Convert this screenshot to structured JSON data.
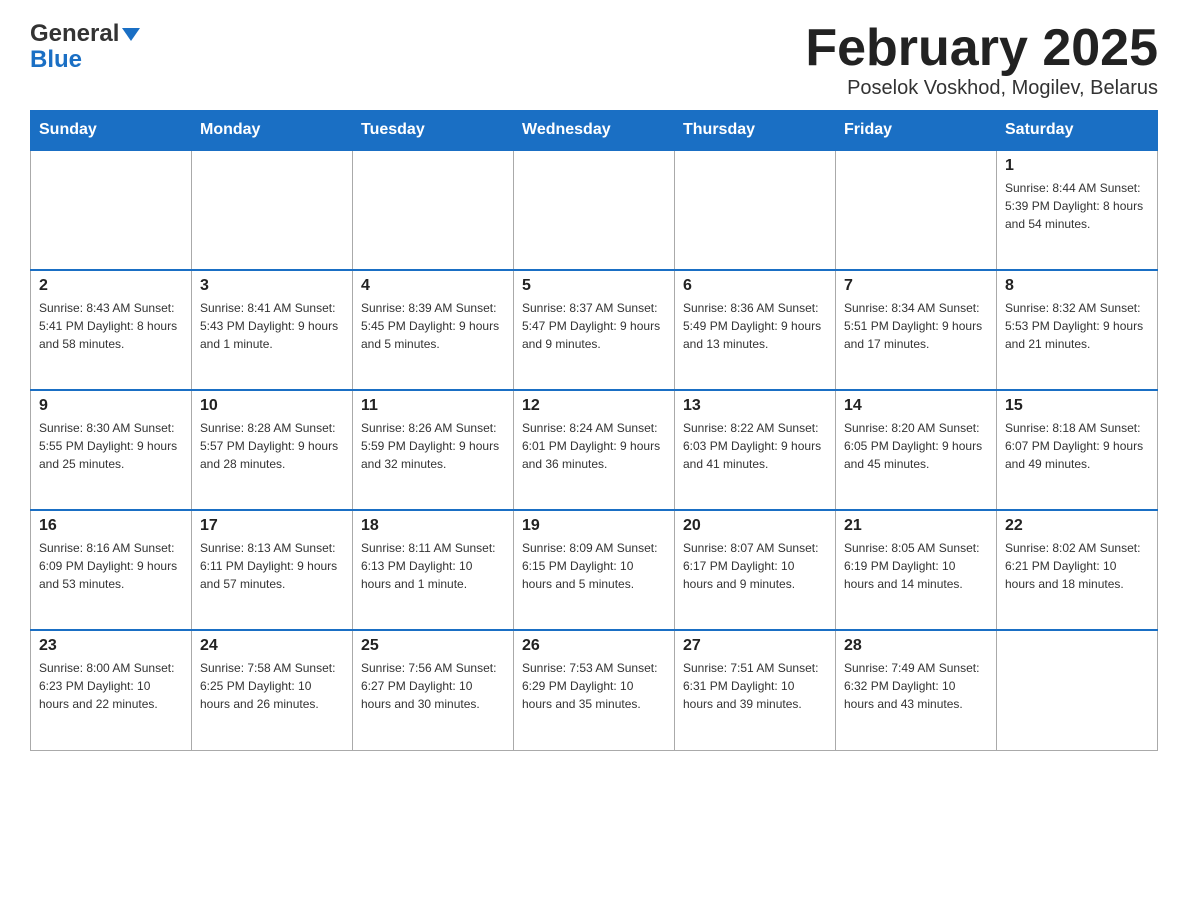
{
  "header": {
    "logo_line1": "General",
    "logo_line2": "Blue",
    "month_title": "February 2025",
    "location": "Poselok Voskhod, Mogilev, Belarus"
  },
  "days_of_week": [
    "Sunday",
    "Monday",
    "Tuesday",
    "Wednesday",
    "Thursday",
    "Friday",
    "Saturday"
  ],
  "weeks": [
    [
      {
        "day": "",
        "info": ""
      },
      {
        "day": "",
        "info": ""
      },
      {
        "day": "",
        "info": ""
      },
      {
        "day": "",
        "info": ""
      },
      {
        "day": "",
        "info": ""
      },
      {
        "day": "",
        "info": ""
      },
      {
        "day": "1",
        "info": "Sunrise: 8:44 AM\nSunset: 5:39 PM\nDaylight: 8 hours and 54 minutes."
      }
    ],
    [
      {
        "day": "2",
        "info": "Sunrise: 8:43 AM\nSunset: 5:41 PM\nDaylight: 8 hours and 58 minutes."
      },
      {
        "day": "3",
        "info": "Sunrise: 8:41 AM\nSunset: 5:43 PM\nDaylight: 9 hours and 1 minute."
      },
      {
        "day": "4",
        "info": "Sunrise: 8:39 AM\nSunset: 5:45 PM\nDaylight: 9 hours and 5 minutes."
      },
      {
        "day": "5",
        "info": "Sunrise: 8:37 AM\nSunset: 5:47 PM\nDaylight: 9 hours and 9 minutes."
      },
      {
        "day": "6",
        "info": "Sunrise: 8:36 AM\nSunset: 5:49 PM\nDaylight: 9 hours and 13 minutes."
      },
      {
        "day": "7",
        "info": "Sunrise: 8:34 AM\nSunset: 5:51 PM\nDaylight: 9 hours and 17 minutes."
      },
      {
        "day": "8",
        "info": "Sunrise: 8:32 AM\nSunset: 5:53 PM\nDaylight: 9 hours and 21 minutes."
      }
    ],
    [
      {
        "day": "9",
        "info": "Sunrise: 8:30 AM\nSunset: 5:55 PM\nDaylight: 9 hours and 25 minutes."
      },
      {
        "day": "10",
        "info": "Sunrise: 8:28 AM\nSunset: 5:57 PM\nDaylight: 9 hours and 28 minutes."
      },
      {
        "day": "11",
        "info": "Sunrise: 8:26 AM\nSunset: 5:59 PM\nDaylight: 9 hours and 32 minutes."
      },
      {
        "day": "12",
        "info": "Sunrise: 8:24 AM\nSunset: 6:01 PM\nDaylight: 9 hours and 36 minutes."
      },
      {
        "day": "13",
        "info": "Sunrise: 8:22 AM\nSunset: 6:03 PM\nDaylight: 9 hours and 41 minutes."
      },
      {
        "day": "14",
        "info": "Sunrise: 8:20 AM\nSunset: 6:05 PM\nDaylight: 9 hours and 45 minutes."
      },
      {
        "day": "15",
        "info": "Sunrise: 8:18 AM\nSunset: 6:07 PM\nDaylight: 9 hours and 49 minutes."
      }
    ],
    [
      {
        "day": "16",
        "info": "Sunrise: 8:16 AM\nSunset: 6:09 PM\nDaylight: 9 hours and 53 minutes."
      },
      {
        "day": "17",
        "info": "Sunrise: 8:13 AM\nSunset: 6:11 PM\nDaylight: 9 hours and 57 minutes."
      },
      {
        "day": "18",
        "info": "Sunrise: 8:11 AM\nSunset: 6:13 PM\nDaylight: 10 hours and 1 minute."
      },
      {
        "day": "19",
        "info": "Sunrise: 8:09 AM\nSunset: 6:15 PM\nDaylight: 10 hours and 5 minutes."
      },
      {
        "day": "20",
        "info": "Sunrise: 8:07 AM\nSunset: 6:17 PM\nDaylight: 10 hours and 9 minutes."
      },
      {
        "day": "21",
        "info": "Sunrise: 8:05 AM\nSunset: 6:19 PM\nDaylight: 10 hours and 14 minutes."
      },
      {
        "day": "22",
        "info": "Sunrise: 8:02 AM\nSunset: 6:21 PM\nDaylight: 10 hours and 18 minutes."
      }
    ],
    [
      {
        "day": "23",
        "info": "Sunrise: 8:00 AM\nSunset: 6:23 PM\nDaylight: 10 hours and 22 minutes."
      },
      {
        "day": "24",
        "info": "Sunrise: 7:58 AM\nSunset: 6:25 PM\nDaylight: 10 hours and 26 minutes."
      },
      {
        "day": "25",
        "info": "Sunrise: 7:56 AM\nSunset: 6:27 PM\nDaylight: 10 hours and 30 minutes."
      },
      {
        "day": "26",
        "info": "Sunrise: 7:53 AM\nSunset: 6:29 PM\nDaylight: 10 hours and 35 minutes."
      },
      {
        "day": "27",
        "info": "Sunrise: 7:51 AM\nSunset: 6:31 PM\nDaylight: 10 hours and 39 minutes."
      },
      {
        "day": "28",
        "info": "Sunrise: 7:49 AM\nSunset: 6:32 PM\nDaylight: 10 hours and 43 minutes."
      },
      {
        "day": "",
        "info": ""
      }
    ]
  ]
}
